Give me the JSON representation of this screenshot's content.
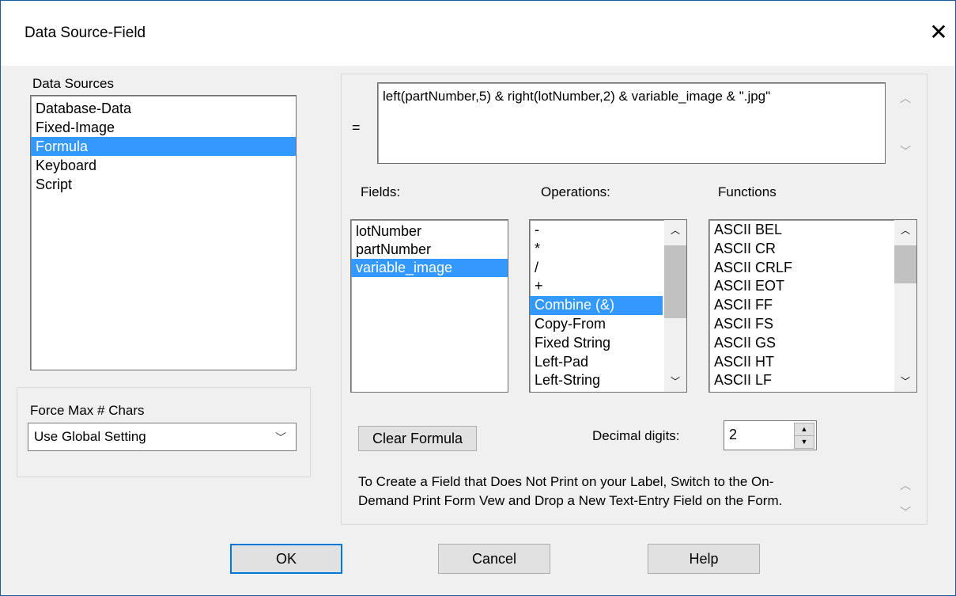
{
  "dialog": {
    "title": "Data Source-Field"
  },
  "data_sources": {
    "label": "Data Sources",
    "items": [
      "Database-Data",
      "Fixed-Image",
      "Formula",
      "Keyboard",
      "Script"
    ],
    "selected": "Formula"
  },
  "force_max": {
    "label": "Force Max # Chars",
    "value": "Use Global Setting"
  },
  "formula": {
    "equals": "=",
    "text": "left(partNumber,5) & right(lotNumber,2) & variable_image & \".jpg\""
  },
  "fields": {
    "label": "Fields:",
    "items": [
      "lotNumber",
      "partNumber",
      "variable_image"
    ],
    "selected": "variable_image"
  },
  "operations": {
    "label": "Operations:",
    "items": [
      "-",
      "*",
      "/",
      "+",
      "Combine (&)",
      "Copy-From",
      "Fixed String",
      "Left-Pad",
      "Left-String"
    ],
    "selected": "Combine (&)"
  },
  "functions": {
    "label": "Functions",
    "items": [
      "ASCII BEL",
      "ASCII CR",
      "ASCII CRLF",
      "ASCII EOT",
      "ASCII FF",
      "ASCII FS",
      "ASCII GS",
      "ASCII HT",
      "ASCII LF"
    ]
  },
  "clear_formula_label": "Clear Formula",
  "decimal": {
    "label": "Decimal digits:",
    "value": "2"
  },
  "hint": {
    "line1": "To Create a Field that Does Not Print on your Label, Switch to the On-",
    "line2": "Demand Print Form Vew and Drop a New Text-Entry Field on the Form."
  },
  "buttons": {
    "ok": "OK",
    "cancel": "Cancel",
    "help": "Help"
  }
}
